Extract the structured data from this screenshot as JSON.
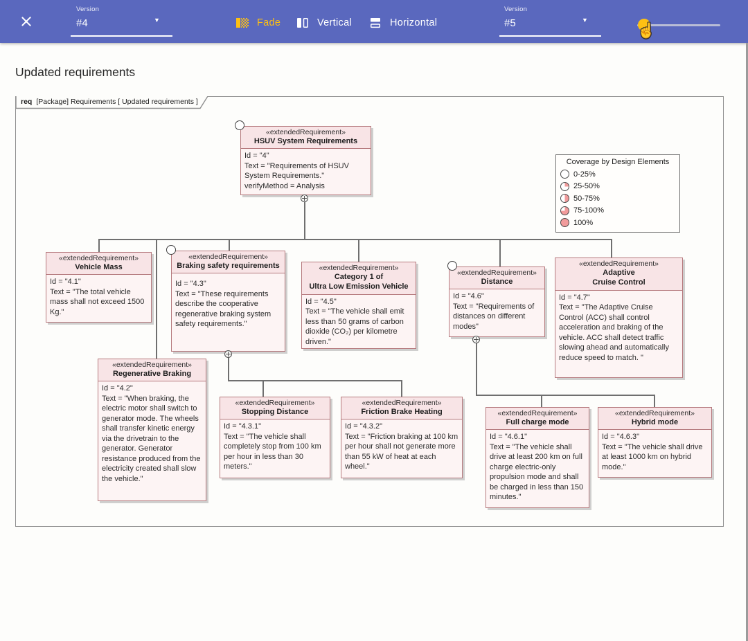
{
  "colors": {
    "toolbar_bg": "#5a68be",
    "accent_amber": "#fdc013",
    "node_header_bg": "#f8e4e6",
    "node_body_bg": "#fdf4f4",
    "node_border": "#b5797d",
    "coverage_fill": "#f19b9b",
    "connector_line": "#6f6f6f"
  },
  "toolbar": {
    "left_version": {
      "label": "Version",
      "value": "#4"
    },
    "right_version": {
      "label": "Version",
      "value": "#5"
    },
    "modes": [
      {
        "label": "Fade"
      },
      {
        "label": "Vertical"
      },
      {
        "label": "Horizontal"
      }
    ],
    "caret": "▼",
    "hand_cursor": "☝"
  },
  "page": {
    "title": "Updated requirements"
  },
  "frame": {
    "keyword": "req",
    "header": "[Package] Requirements [ Updated requirements  ]"
  },
  "legend": {
    "title": "Coverage by Design Elements",
    "items": [
      {
        "label": "0-25%"
      },
      {
        "label": "25-50%"
      },
      {
        "label": "50-75%"
      },
      {
        "label": "75-100%"
      },
      {
        "label": "100%"
      }
    ]
  },
  "nodes": [
    {
      "stereotype": "«extendedRequirement»",
      "name": "HSUV System Requirements",
      "lines": [
        "Id = \"4\"",
        "Text = \"Requirements of HSUV System Requirements.\"",
        "verifyMethod = Analysis"
      ]
    },
    {
      "stereotype": "«extendedRequirement»",
      "name": "Vehicle Mass",
      "lines": [
        "Id = \"4.1\"",
        "Text = \"The total vehicle mass shall not exceed 1500 Kg.\""
      ]
    },
    {
      "stereotype": "«extendedRequirement»",
      "name": "Braking safety requirements",
      "lines": [
        "Id = \"4.3\"",
        "Text = \"These requirements describe the cooperative regenerative braking system safety requirements.\""
      ]
    },
    {
      "stereotype": "«extendedRequirement»",
      "name": "Category 1 of\nUltra Low Emission Vehicle",
      "lines": [
        "Id = \"4.5\"",
        "Text = \"The vehicle shall emit less than 50 grams of carbon dioxide (CO₂) per kilometre driven.\""
      ]
    },
    {
      "stereotype": "«extendedRequirement»",
      "name": "Distance",
      "lines": [
        "Id = \"4.6\"",
        "Text = \"Requirements of distances on different modes\""
      ]
    },
    {
      "stereotype": "«extendedRequirement»",
      "name": "Adaptive\nCruise Control",
      "lines": [
        "Id = \"4.7\"",
        "Text = \"The Adaptive Cruise Control (ACC) shall control acceleration and braking of the vehicle. ACC shall detect traffic slowing ahead and automatically reduce speed to match. \""
      ]
    },
    {
      "stereotype": "«extendedRequirement»",
      "name": "Regenerative Braking",
      "lines": [
        "Id = \"4.2\"",
        "Text = \"When braking, the electric motor shall switch to generator mode. The wheels shall transfer kinetic energy via the drivetrain to the generator. Generator resistance produced from the electricity created shall slow the vehicle.\""
      ]
    },
    {
      "stereotype": "«extendedRequirement»",
      "name": "Stopping Distance",
      "lines": [
        "Id = \"4.3.1\"",
        "Text = \"The vehicle shall completely stop from 100 km per hour in less than 30 meters.\""
      ]
    },
    {
      "stereotype": "«extendedRequirement»",
      "name": "Friction Brake Heating",
      "lines": [
        "Id = \"4.3.2\"",
        "Text = \"Friction braking at 100 km per hour shall not generate more than 55 kW of heat at each wheel.\""
      ]
    },
    {
      "stereotype": "«extendedRequirement»",
      "name": "Full charge mode",
      "lines": [
        "Id = \"4.6.1\"",
        "Text = \"The vehicle shall drive at least 200 km on full charge electric-only propulsion mode and shall be charged in less than 150 minutes.\""
      ]
    },
    {
      "stereotype": "«extendedRequirement»",
      "name": "Hybrid mode",
      "lines": [
        "Id = \"4.6.3\"",
        "Text = \"The vehicle shall drive at least 1000 km on hybrid mode.\""
      ]
    }
  ]
}
